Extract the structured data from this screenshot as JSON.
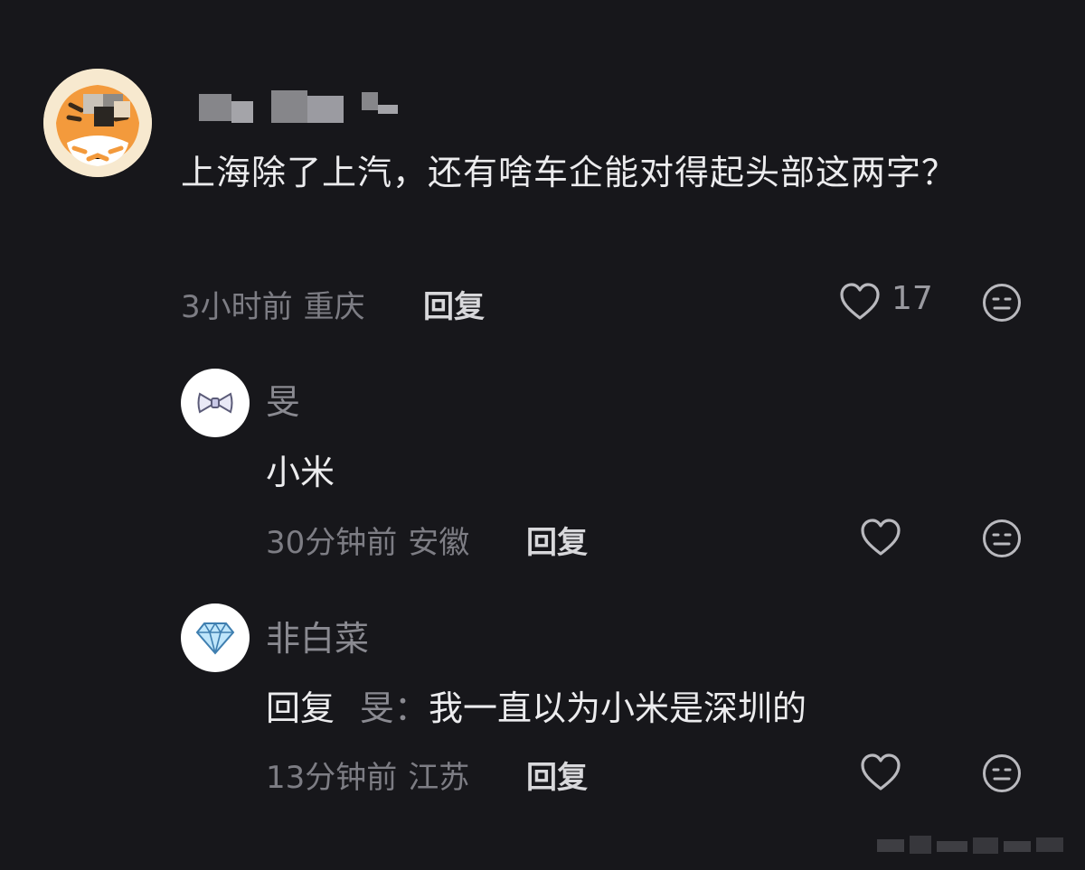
{
  "main_comment": {
    "avatar": "tiger-avatar",
    "text": "上海除了上汽，还有啥车企能对得起头部这两字？",
    "time": "3小时前",
    "location": "重庆",
    "reply_label": "回复",
    "likes": "17",
    "like_icon": "heart-icon",
    "react_icon": "neutral-face-icon"
  },
  "replies": [
    {
      "username": "旻",
      "avatar": "bow-avatar",
      "text": "小米",
      "time": "30分钟前",
      "location": "安徽",
      "reply_label": "回复"
    },
    {
      "username": "非白菜",
      "avatar": "diamond-avatar",
      "reply_prefix": "回复",
      "reply_target": "旻：",
      "text": "我一直以为小米是深圳的",
      "time": "13分钟前",
      "location": "江苏",
      "reply_label": "回复"
    }
  ],
  "colors": {
    "background": "#17171b",
    "primary_text": "#ececee",
    "secondary_text": "#7d7d84"
  }
}
